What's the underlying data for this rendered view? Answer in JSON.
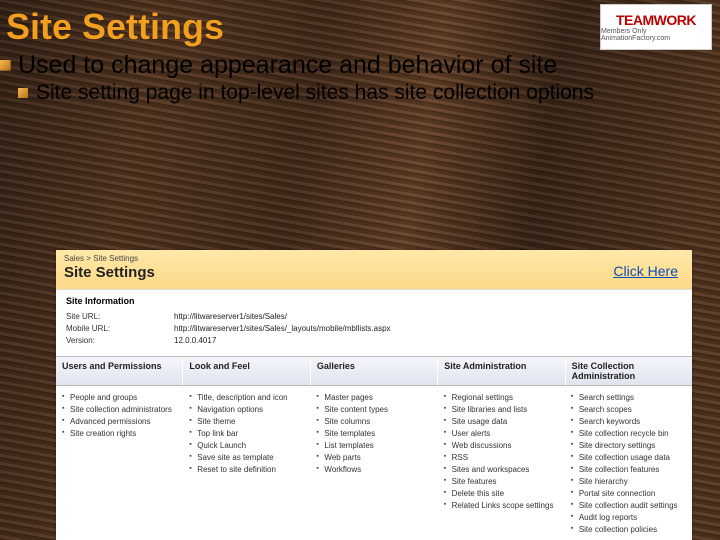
{
  "title": "Site Settings",
  "logo": {
    "brand": "TEAMWORK",
    "sub": "Members Only AnimationFactory.com"
  },
  "bullet1": "Used to change appearance and behavior of site",
  "bullet2": "Site setting page in top-level sites has site collection options",
  "crumb": "Sales > Site Settings",
  "page_heading": "Site Settings",
  "click_here": "Click Here",
  "info_title": "Site Information",
  "info_rows": [
    {
      "label": "Site URL:",
      "value": "http://litwareserver1/sites/Sales/"
    },
    {
      "label": "Mobile URL:",
      "value": "http://litwareserver1/sites/Sales/_layouts/mobile/mbllists.aspx"
    },
    {
      "label": "Version:",
      "value": "12.0.0.4017"
    }
  ],
  "column_headers": [
    "Users and Permissions",
    "Look and Feel",
    "Galleries",
    "Site Administration",
    "Site Collection Administration"
  ],
  "columns": [
    [
      "People and groups",
      "Site collection administrators",
      "Advanced permissions",
      "Site creation rights"
    ],
    [
      "Title, description and icon",
      "Navigation options",
      "Site theme",
      "Top link bar",
      "Quick Launch",
      "Save site as template",
      "Reset to site definition"
    ],
    [
      "Master pages",
      "Site content types",
      "Site columns",
      "Site templates",
      "List templates",
      "Web parts",
      "Workflows"
    ],
    [
      "Regional settings",
      "Site libraries and lists",
      "Site usage data",
      "User alerts",
      "Web discussions",
      "RSS",
      "Sites and workspaces",
      "Site features",
      "Delete this site",
      "Related Links scope settings"
    ],
    [
      "Search settings",
      "Search scopes",
      "Search keywords",
      "Site collection recycle bin",
      "Site directory settings",
      "Site collection usage data",
      "Site collection features",
      "Site hierarchy",
      "Portal site connection",
      "Site collection audit settings",
      "Audit log reports",
      "Site collection policies"
    ]
  ]
}
